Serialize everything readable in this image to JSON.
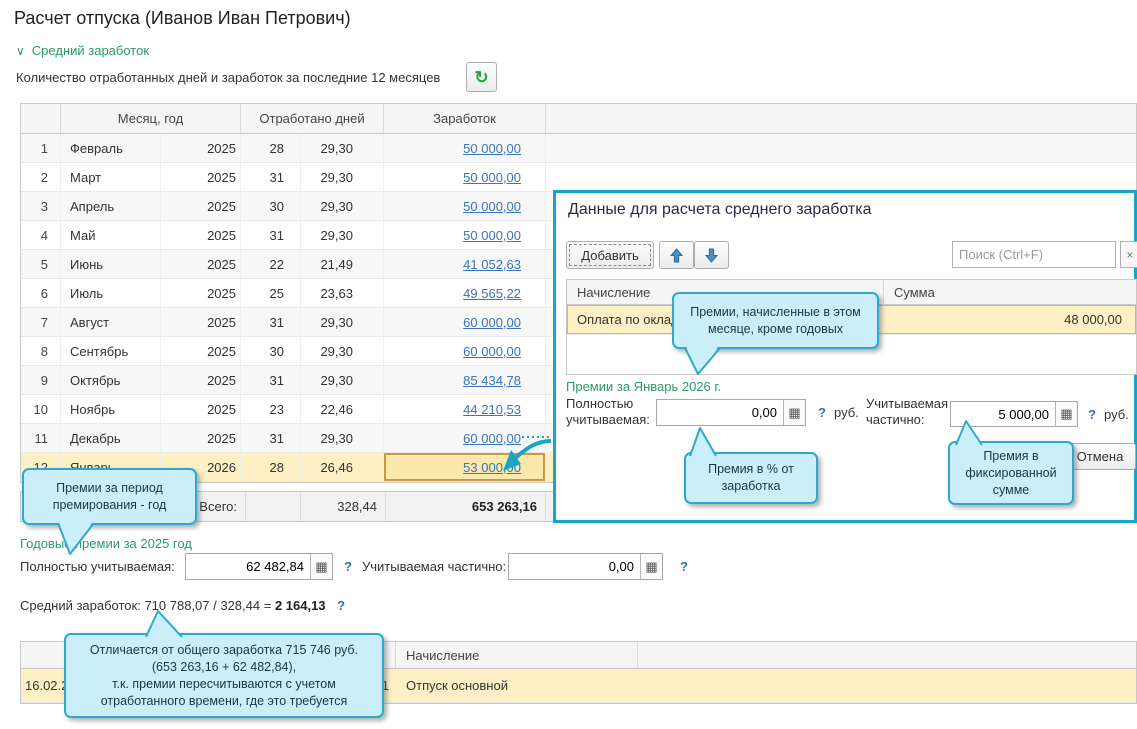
{
  "page": {
    "title": "Расчет отпуска (Иванов Иван Петрович)"
  },
  "average_section": {
    "header": "Средний заработок",
    "chevron": "∨",
    "subtitle": "Количество отработанных дней и заработок за последние 12 месяцев",
    "refresh_icon": "↻"
  },
  "earnings_table": {
    "headers": {
      "month_year": "Месяц, год",
      "days_worked": "Отработано дней",
      "earnings": "Заработок"
    },
    "rows": [
      {
        "n": "1",
        "month": "Февраль",
        "year": "2025",
        "days": "28",
        "coef": "29,30",
        "amount": "50 000,00"
      },
      {
        "n": "2",
        "month": "Март",
        "year": "2025",
        "days": "31",
        "coef": "29,30",
        "amount": "50 000,00"
      },
      {
        "n": "3",
        "month": "Апрель",
        "year": "2025",
        "days": "30",
        "coef": "29,30",
        "amount": "50 000,00"
      },
      {
        "n": "4",
        "month": "Май",
        "year": "2025",
        "days": "31",
        "coef": "29,30",
        "amount": "50 000,00"
      },
      {
        "n": "5",
        "month": "Июнь",
        "year": "2025",
        "days": "22",
        "coef": "21,49",
        "amount": "41 052,63"
      },
      {
        "n": "6",
        "month": "Июль",
        "year": "2025",
        "days": "25",
        "coef": "23,63",
        "amount": "49 565,22"
      },
      {
        "n": "7",
        "month": "Август",
        "year": "2025",
        "days": "31",
        "coef": "29,30",
        "amount": "60 000,00"
      },
      {
        "n": "8",
        "month": "Сентябрь",
        "year": "2025",
        "days": "30",
        "coef": "29,30",
        "amount": "60 000,00"
      },
      {
        "n": "9",
        "month": "Октябрь",
        "year": "2025",
        "days": "31",
        "coef": "29,30",
        "amount": "85 434,78"
      },
      {
        "n": "10",
        "month": "Ноябрь",
        "year": "2025",
        "days": "23",
        "coef": "22,46",
        "amount": "44 210,53"
      },
      {
        "n": "11",
        "month": "Декабрь",
        "year": "2025",
        "days": "31",
        "coef": "29,30",
        "amount": "60 000,00"
      },
      {
        "n": "12",
        "month": "Январь",
        "year": "2026",
        "days": "28",
        "coef": "26,46",
        "amount": "53 000,00"
      }
    ],
    "total": {
      "label": "Всего:",
      "coef": "328,44",
      "amount": "653 263,16"
    }
  },
  "annual_bonus": {
    "link": "Годовые премии за 2025 год",
    "full_label": "Полностью учитываемая:",
    "full_value": "62 482,84",
    "partial_label": "Учитываемая частично:",
    "partial_value": "0,00",
    "help": "?",
    "calc_icon": "▦"
  },
  "average_line": {
    "prefix": "Средний заработок: 710 788,07 / 328,44 = ",
    "result": "2 164,13",
    "help": "?"
  },
  "accrual_table": {
    "header_accrual": "Начисление",
    "row": {
      "date_fragment": "16.02.2",
      "amount_fragment": "91",
      "accrual": "Отпуск основной"
    }
  },
  "dialog": {
    "title": "Данные для расчета среднего заработка",
    "add_button": "Добавить",
    "search_placeholder": "Поиск (Ctrl+F)",
    "clear": "×",
    "table": {
      "col_accrual": "Начисление",
      "col_sum": "Сумма",
      "row": {
        "accrual": "Оплата по окладу",
        "sum": "48 000,00"
      }
    },
    "bonus_link": "Премии за Январь 2026 г.",
    "full_label_line1": "Полностью",
    "full_label_line2": "учитываемая:",
    "full_value": "0,00",
    "partial_label_line1": "Учитываемая",
    "partial_label_line2": "частично:",
    "partial_value": "5 000,00",
    "rub": "руб.",
    "help": "?",
    "calc_icon": "▦",
    "cancel_button": "Отмена"
  },
  "callouts": {
    "monthly": {
      "line1": "Премии, начисленные в этом",
      "line2": "месяце, кроме годовых"
    },
    "percent": {
      "line1": "Премия в % от",
      "line2": "заработка"
    },
    "fixed": {
      "line1": "Премия в",
      "line2": "фиксированной",
      "line3": "сумме"
    },
    "period": {
      "line1": "Премии за период",
      "line2": "премирования - год"
    },
    "diff": {
      "line1": "Отличается от общего заработка 715 746 руб.",
      "line2": "(653 263,16 + 62 482,84),",
      "line3": "т.к. премии пересчитываются с учетом",
      "line4": "отработанного времени, где это требуется"
    }
  },
  "colors": {
    "accent_teal": "#17a6c6",
    "green_link": "#2b9a67",
    "blue_link": "#3b74b8",
    "row_highlight": "#fdf0c5",
    "callout_fill": "#cbeefb",
    "callout_border": "#2da9cd"
  }
}
